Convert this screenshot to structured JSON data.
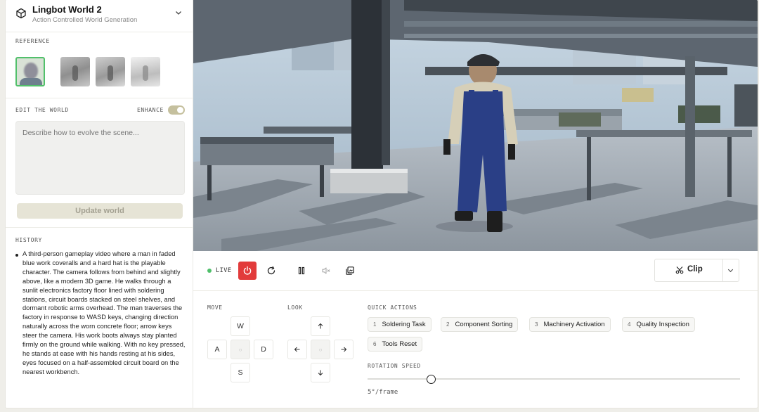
{
  "app": {
    "title": "Lingbot World 2",
    "subtitle": "Action Controlled World Generation"
  },
  "reference": {
    "label": "REFERENCE"
  },
  "edit": {
    "label": "EDIT THE WORLD",
    "enhance_label": "ENHANCE",
    "enhance_on": true,
    "placeholder": "Describe how to evolve the scene...",
    "update_label": "Update world"
  },
  "history": {
    "label": "HISTORY",
    "items": [
      "A third-person gameplay video where a man in faded blue work coveralls and a hard hat is the playable character. The camera follows from behind and slightly above, like a modern 3D game. He walks through a sunlit electronics factory floor lined with soldering stations, circuit boards stacked on steel shelves, and dormant robotic arms overhead. The man traverses the factory in response to WASD keys, changing direction naturally across the worn concrete floor; arrow keys steer the camera. His work boots always stay planted firmly on the ground while walking. With no key pressed, he stands at ease with his hands resting at his sides, eyes focused on a half-assembled circuit board on the nearest workbench."
    ]
  },
  "player": {
    "live_label": "LIVE",
    "clip_label": "Clip"
  },
  "move": {
    "label": "MOVE",
    "keys": {
      "up": "W",
      "left": "A",
      "center": "○",
      "right": "D",
      "down": "S"
    }
  },
  "look": {
    "label": "LOOK",
    "center": "○"
  },
  "quick_actions": {
    "label": "QUICK ACTIONS",
    "items": [
      {
        "num": "1",
        "label": "Soldering Task"
      },
      {
        "num": "2",
        "label": "Component Sorting"
      },
      {
        "num": "3",
        "label": "Machinery Activation"
      },
      {
        "num": "4",
        "label": "Quality Inspection"
      },
      {
        "num": "6",
        "label": "Tools Reset"
      }
    ]
  },
  "rotation": {
    "label": "ROTATION SPEED",
    "value_text": "5°/frame",
    "level": 0.17
  },
  "colors": {
    "live": "#4fbf6a",
    "power": "#e23b3b",
    "selected_border": "#52c06b",
    "toggle": "#c5c09e"
  }
}
